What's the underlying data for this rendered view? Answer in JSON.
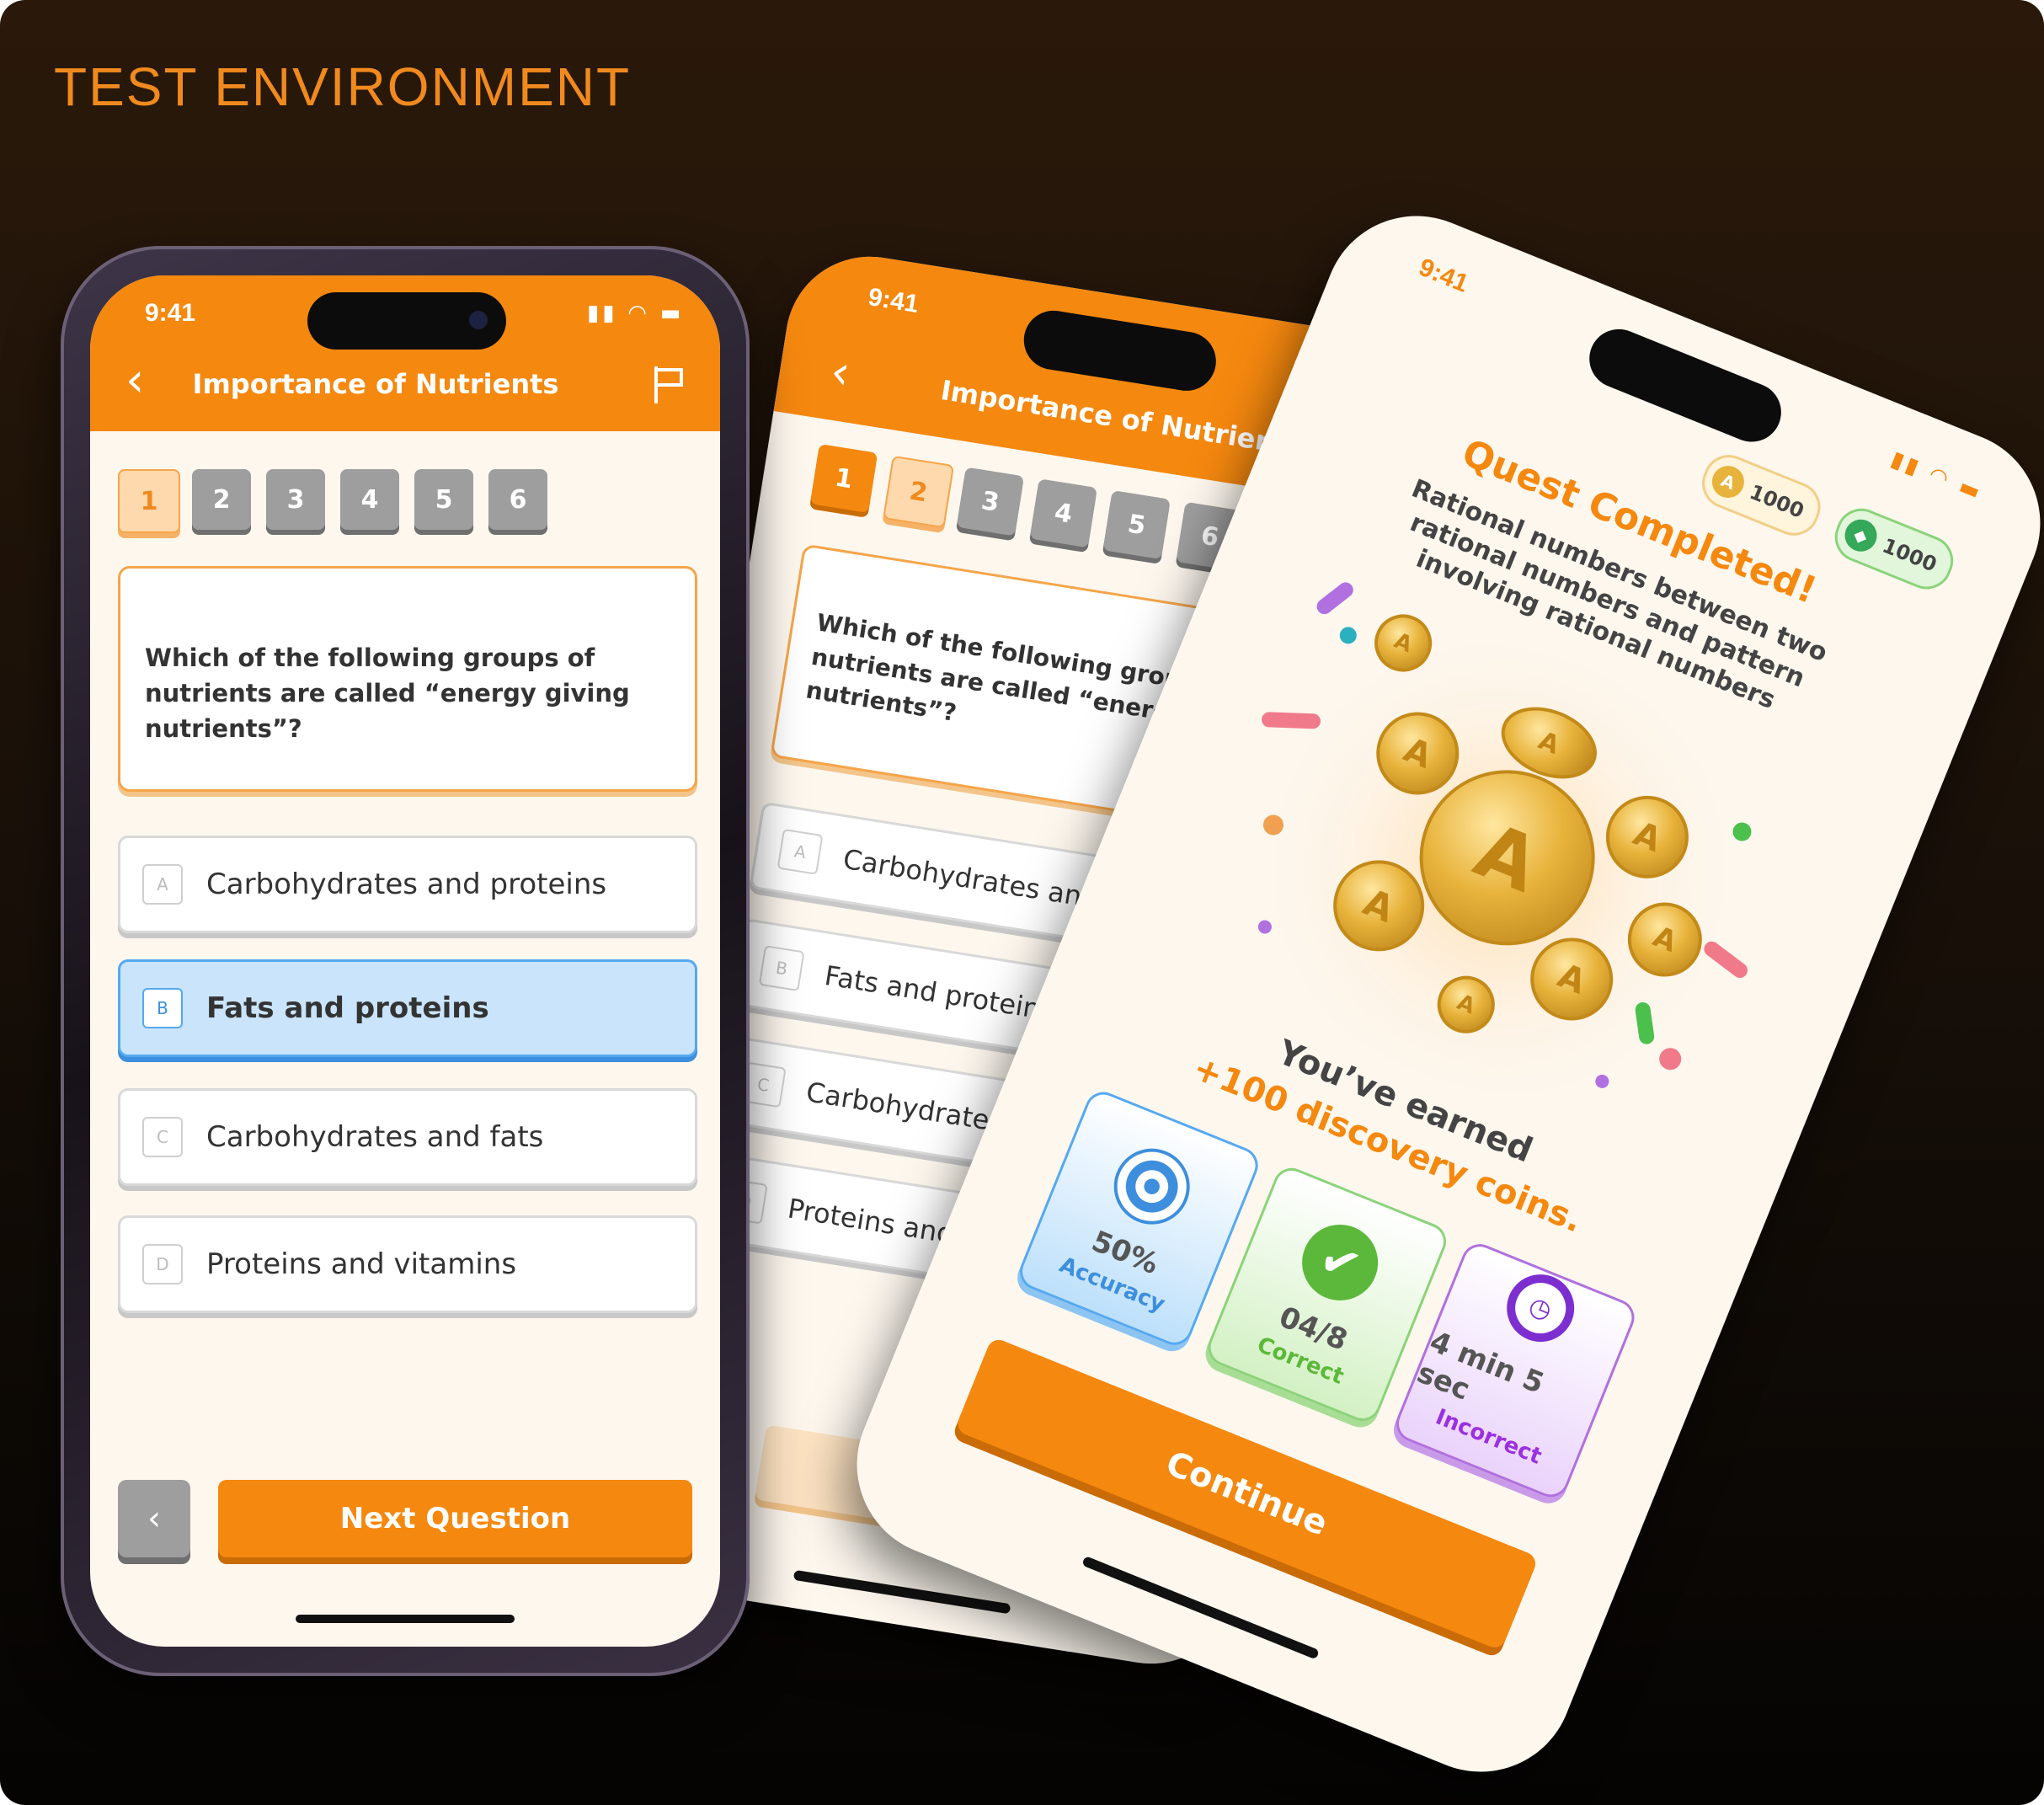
{
  "header": {
    "env_label": "TEST ENVIRONMENT"
  },
  "status": {
    "time": "9:41"
  },
  "quiz": {
    "title": "Importance of Nutrients",
    "question_numbers": [
      "1",
      "2",
      "3",
      "4",
      "5",
      "6"
    ],
    "question": "Which of the following groups of nutrients are called “energy giving nutrients”?",
    "options": [
      {
        "letter": "A",
        "text": "Carbohydrates and proteins"
      },
      {
        "letter": "B",
        "text": "Fats and proteins"
      },
      {
        "letter": "C",
        "text": "Carbohydrates and fats"
      },
      {
        "letter": "D",
        "text": "Proteins and vitamins"
      }
    ],
    "selected_option": "B",
    "next_label": "Next Question",
    "prev_glyph": "‹",
    "back_glyph": "‹",
    "flag_icon": "flag-icon"
  },
  "result": {
    "heading": "Quest Completed!",
    "subtitle": "Rational numbers between two rational numbers and pattern involving rational numbers",
    "coins_balance": "1000",
    "gems_balance": "1000",
    "earned_line1": "You’ve earned",
    "earned_line2": "+100 discovery coins.",
    "stats": [
      {
        "value": "50%",
        "label": "Accuracy",
        "icon": "target-icon",
        "color": "#3d8fdd"
      },
      {
        "value": "04/8",
        "label": "Correct",
        "icon": "check-circle-icon",
        "color": "#5cb83a"
      },
      {
        "value": "4 min 5 sec",
        "label": "Incorrect",
        "icon": "stopwatch-icon",
        "color": "#9b30e0"
      }
    ],
    "continue_label": "Continue"
  },
  "colors": {
    "accent": "#f5880f",
    "selected": "#c9e4fb",
    "background": "#fdf7ee"
  }
}
